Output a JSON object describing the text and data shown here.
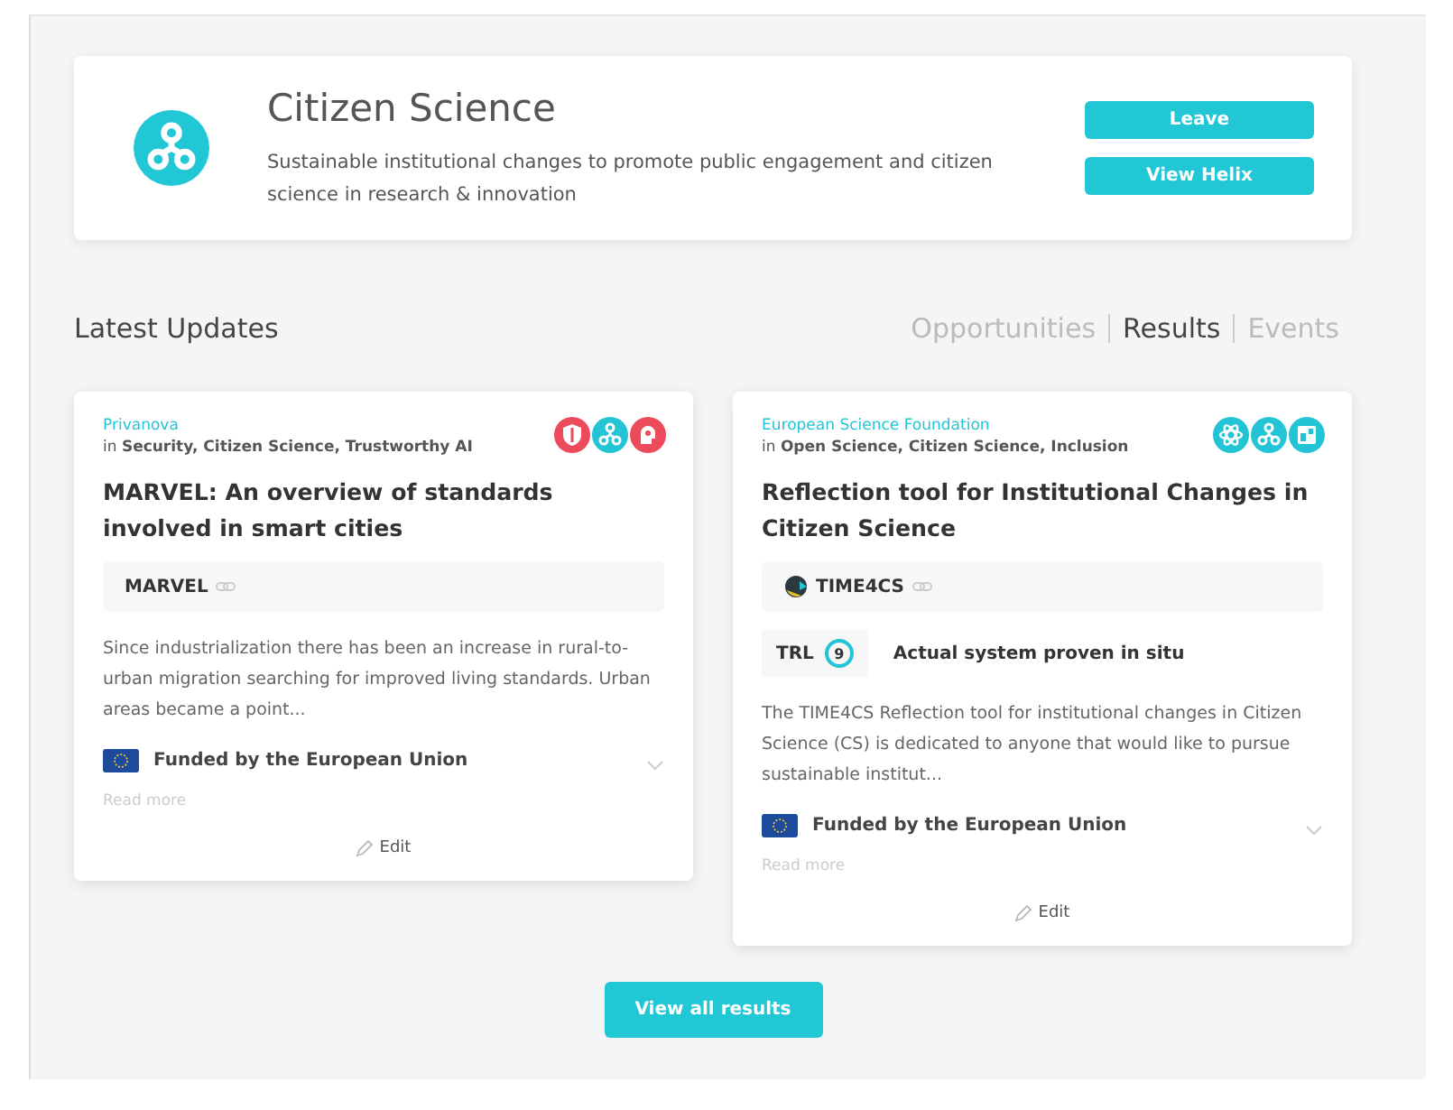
{
  "helix": {
    "title": "Citizen Science",
    "description": "Sustainable institutional changes to promote public engagement and citizen science in research & innovation",
    "buttons": [
      "Leave",
      "View Helix"
    ]
  },
  "updates": {
    "title": "Latest Updates",
    "tabs": [
      {
        "label": "Opportunities",
        "selected": false
      },
      {
        "label": "Results",
        "selected": true
      },
      {
        "label": "Events",
        "selected": false
      }
    ]
  },
  "cards": [
    {
      "organisation": "Privanova",
      "in": "in",
      "topics_text": "Security, Citizen Science, Trustworthy AI",
      "topics": [
        {
          "kind": "shield",
          "color": "#ec4b5c"
        },
        {
          "kind": "hub",
          "color": "#22c4d6"
        },
        {
          "kind": "head",
          "color": "#ec4b5c"
        }
      ],
      "title": "MARVEL: An overview of standards involved in smart cities",
      "project": {
        "name": "MARVEL",
        "has_logo": false
      },
      "summary": "Since industrialization there has been an increase in rural-to-urban migration searching for improved living standards. Urban areas became a point...",
      "funding": {
        "label": "Funded by the European Union",
        "expanded": false
      },
      "read_more": "Read more",
      "edit": "Edit"
    },
    {
      "organisation": "European Science Foundation",
      "in": "in",
      "topics_text": "Open Science, Citizen Science, Inclusion",
      "topics": [
        {
          "kind": "atom",
          "color": "#22c4d6"
        },
        {
          "kind": "hub",
          "color": "#22c4d6"
        },
        {
          "kind": "panel",
          "color": "#22c4d6"
        }
      ],
      "title": "Reflection tool for Institutional Changes in Citizen Science",
      "project": {
        "name": "TIME4CS",
        "has_logo": true
      },
      "trl": {
        "label": "TRL",
        "value": "9",
        "description": "Actual system proven in situ"
      },
      "summary": "The TIME4CS Reflection tool for institutional changes in Citizen Science (CS) is dedicated to anyone that would like to pursue sustainable institut...",
      "funding": {
        "label": "Funded by the European Union",
        "expanded": false
      },
      "read_more": "Read more",
      "edit": "Edit"
    }
  ],
  "view_all": "View all results"
}
